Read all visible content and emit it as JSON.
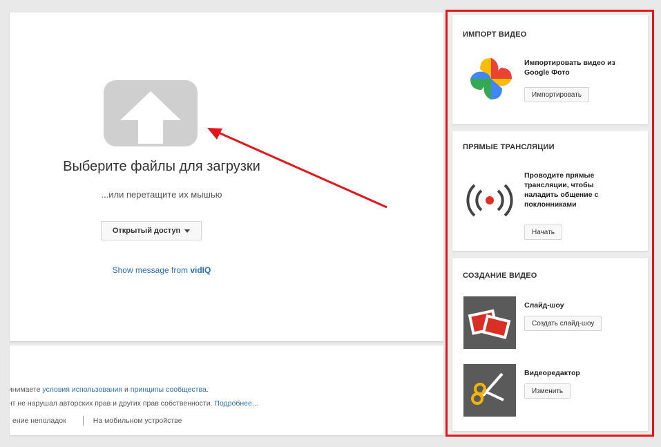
{
  "upload": {
    "title": "Выберите файлы для загрузки",
    "subtitle": "...или перетащите их мышью",
    "privacy_label": "Открытый доступ",
    "vidiq_prefix": "Show message from ",
    "vidiq_brand": "vidIQ"
  },
  "footer": {
    "line1_prefix": "ринимаете ",
    "line1_link1": "условия использования",
    "line1_mid": " и ",
    "line1_link2": "принципы сообщества",
    "line1_end": ".",
    "line2_prefix": "ент не нарушал авторских прав и других прав собственности. ",
    "line2_link": "Подробнее...",
    "line3_item1": "ение неполадок",
    "line3_item2": "На мобильном устройстве"
  },
  "import_card": {
    "title": "Импорт видео",
    "text": "Импортировать видео из Google Фото",
    "button": "Импортировать",
    "icon": "google-photos-icon"
  },
  "live_card": {
    "title": "Прямые трансляции",
    "text": "Проводите прямые трансляции, чтобы наладить общение с поклонниками",
    "button": "Начать",
    "icon": "live-broadcast-icon"
  },
  "create_card": {
    "title": "Создание видео",
    "slideshow_label": "Слайд-шоу",
    "slideshow_button": "Создать слайд-шоу",
    "editor_label": "Видеоредактор",
    "editor_button": "Изменить"
  },
  "colors": {
    "highlight": "#e2161b",
    "link": "#2b6fb6",
    "upload_icon": "#cfcfcf"
  }
}
